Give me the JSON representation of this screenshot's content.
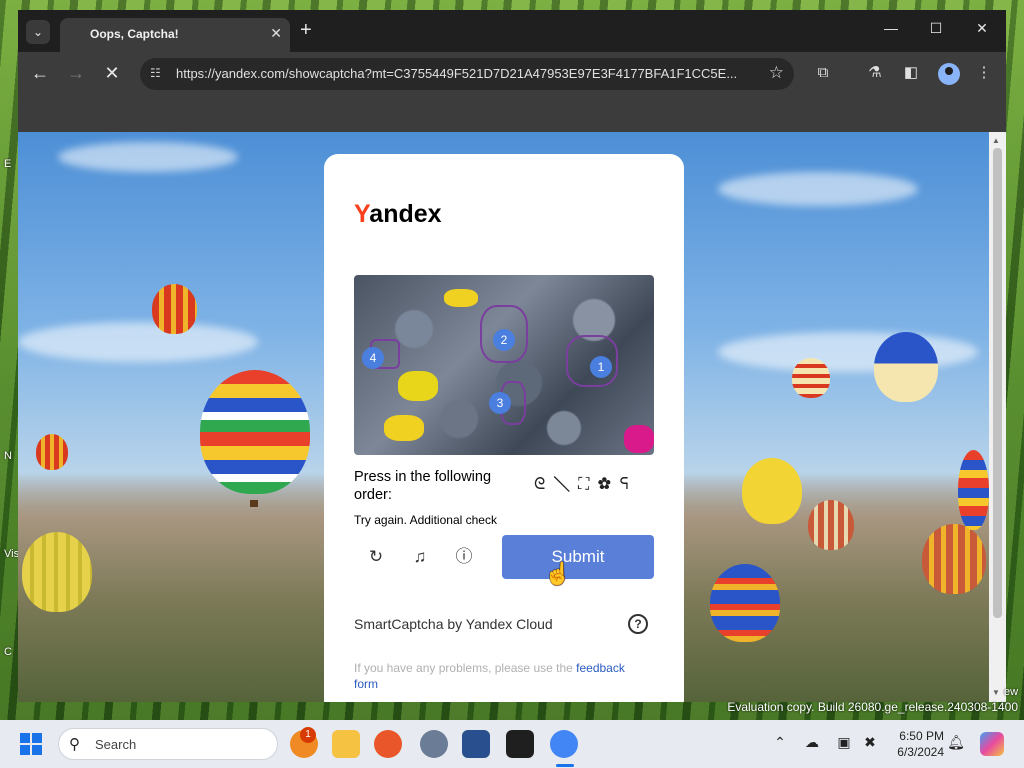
{
  "desktop": {
    "labels": [
      "E",
      "N",
      "Vis",
      "C"
    ],
    "watermark": "Evaluation copy. Build 26080.ge_release.240308-1400",
    "partial_label": "ew"
  },
  "browser": {
    "tab": {
      "title": "Oops, Captcha!",
      "close": "✕"
    },
    "new_tab": "+",
    "window_controls": {
      "minimize": "—",
      "maximize": "☐",
      "close": "✕"
    },
    "nav": {
      "back": "←",
      "forward": "→",
      "stop": "✕"
    },
    "url": "https://yandex.com/showcaptcha?mt=C3755449F521D7D21A47953E97E3F4177BFA1F1CC5E...",
    "accent": "#8ab4f8"
  },
  "captcha": {
    "logo_first": "Y",
    "logo_rest": "andex",
    "markers": [
      "1",
      "2",
      "3",
      "4"
    ],
    "instruction": "Press in the following order:",
    "order_glyphs": "ᘓ ╲ ⛶ ✿ ᕋ",
    "error": "Try again. Additional check",
    "submit": "Submit",
    "brand": "SmartCaptcha by Yandex Cloud",
    "help": "?",
    "feedback_prefix": "If you have any problems, please use the ",
    "feedback_link": "feedback form",
    "submit_color": "#5a7fd8",
    "logo_color": "#fc3f1d"
  },
  "taskbar": {
    "search_label": "Search",
    "notification_count": "1",
    "clock_time": "6:50 PM",
    "clock_date": "6/3/2024",
    "apps": [
      "file-explorer",
      "firefox",
      "settings",
      "virtualbox",
      "epic-games",
      "chrome"
    ]
  }
}
